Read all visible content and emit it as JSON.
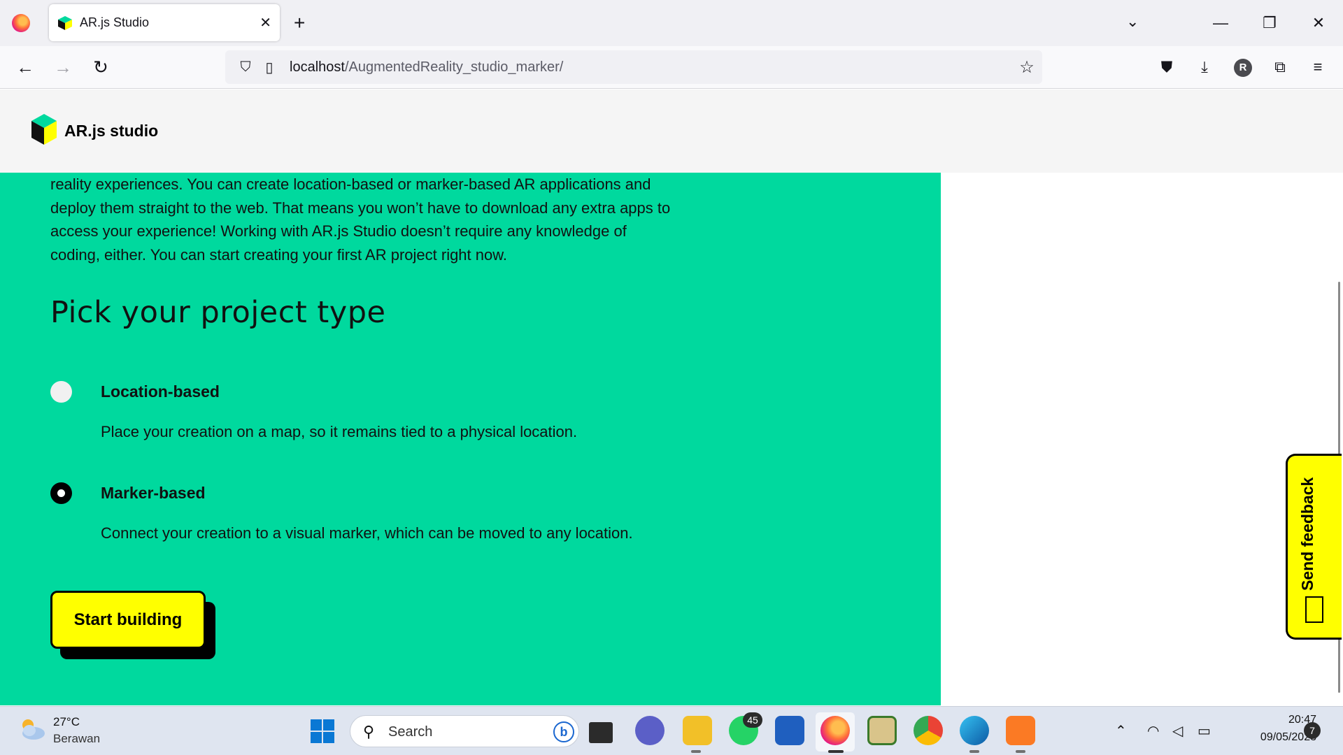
{
  "browser": {
    "tab_title": "AR.js Studio",
    "tab_close": "✕",
    "new_tab": "+",
    "url_host": "localhost",
    "url_path": "/AugmentedReality_studio_marker/",
    "window_controls": {
      "list": "⌄",
      "minimize": "—",
      "restore": "❐",
      "close": "✕"
    },
    "profile_initial": "R"
  },
  "site": {
    "name": "AR.js studio"
  },
  "main": {
    "intro_text": "reality experiences. You can create location-based or marker-based AR applications and deploy them straight to the web. That means you won’t have to download any extra apps to access your experience! Working with AR.js Studio doesn’t require any knowledge of coding, either. You can start creating your first AR project right now.",
    "section_title": "Pick your project type",
    "options": [
      {
        "label": "Location-based",
        "description": "Place your creation on a map, so it remains tied to a physical location.",
        "selected": false
      },
      {
        "label": "Marker-based",
        "description": "Connect your creation to a visual marker, which can be moved to any location.",
        "selected": true
      }
    ],
    "start_button": "Start building"
  },
  "feedback": {
    "label": "Send feedback"
  },
  "taskbar": {
    "weather_temp": "27°C",
    "weather_desc": "Berawan",
    "search_placeholder": "Search",
    "whatsapp_badge": "45",
    "clock_time": "20:47",
    "clock_date": "09/05/2023",
    "notification_count": "7"
  },
  "colors": {
    "accent_green": "#00d99e",
    "button_yellow": "#ffff00"
  }
}
